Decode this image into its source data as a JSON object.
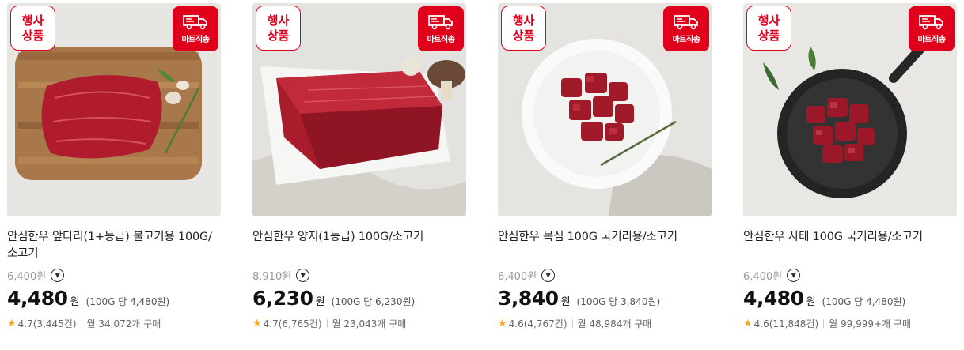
{
  "badges": {
    "event": "행사상품",
    "mart": "마트직송"
  },
  "products": [
    {
      "name": "안심한우 앞다리(1+등급) 불고기용 100G/소고기",
      "original_price": "6,400",
      "price": "4,480",
      "currency": "원",
      "unit_price": "(100G 당 4,480원)",
      "rating": "4.7",
      "reviews": "(3,445건)",
      "sales": "월 34,072개 구매"
    },
    {
      "name": "안심한우 양지(1등급) 100G/소고기",
      "original_price": "8,910",
      "price": "6,230",
      "currency": "원",
      "unit_price": "(100G 당 6,230원)",
      "rating": "4.7",
      "reviews": "(6,765건)",
      "sales": "월 23,043개 구매"
    },
    {
      "name": "안심한우 목심 100G 국거리용/소고기",
      "original_price": "6,400",
      "price": "3,840",
      "currency": "원",
      "unit_price": "(100G 당 3,840원)",
      "rating": "4.6",
      "reviews": "(4,767건)",
      "sales": "월 48,984개 구매"
    },
    {
      "name": "안심한우 사태 100G 국거리용/소고기",
      "original_price": "6,400",
      "price": "4,480",
      "currency": "원",
      "unit_price": "(100G 당 4,480원)",
      "rating": "4.6",
      "reviews": "(11,848건)",
      "sales": "월 99,999+개 구매"
    }
  ],
  "colors": {
    "accent": "#e0001b",
    "star": "#f5a623"
  }
}
